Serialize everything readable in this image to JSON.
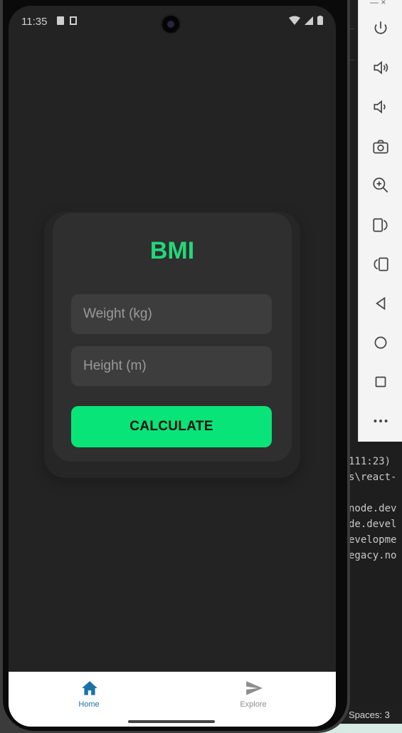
{
  "status_bar": {
    "time": "11:35"
  },
  "card": {
    "title": "BMI",
    "weight_placeholder": "Weight (kg)",
    "height_placeholder": "Height (m)",
    "calculate_label": "CALCULATE",
    "title_color": "#22d97a",
    "button_color": "#08e478"
  },
  "tabs": [
    {
      "label": "Home",
      "icon": "home-icon",
      "active": true,
      "color": "#1a73a8"
    },
    {
      "label": "Explore",
      "icon": "send-icon",
      "active": false,
      "color": "#8e8e8e"
    }
  ],
  "emulator_toolbar": {
    "items": [
      "power-icon",
      "volume-up-icon",
      "volume-down-icon",
      "camera-icon",
      "zoom-in-icon",
      "rotate-right-icon",
      "rotate-left-icon",
      "back-icon",
      "home-circle-icon",
      "overview-icon",
      "more-icon"
    ]
  },
  "editor": {
    "lines": [
      "111:23)",
      "s\\react-",
      "",
      "node.dev",
      "de.devel",
      "evelopme",
      "egacy.no"
    ],
    "status": "Spaces: 3"
  }
}
